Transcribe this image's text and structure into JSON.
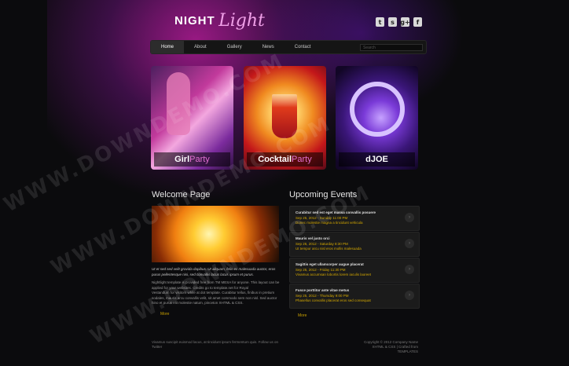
{
  "logo": {
    "word1": "NIGHT",
    "word2": "Light"
  },
  "social": [
    {
      "icon": "twitter-icon",
      "glyph": "t"
    },
    {
      "icon": "skype-icon",
      "glyph": "s"
    },
    {
      "icon": "google-plus-icon",
      "glyph": "g+"
    },
    {
      "icon": "facebook-icon",
      "glyph": "f"
    }
  ],
  "nav": {
    "items": [
      "Home",
      "About",
      "Gallery",
      "News",
      "Contact"
    ],
    "active": "Home",
    "search_placeholder": "Search"
  },
  "cards": [
    {
      "title": "Girl",
      "suffix": "Party"
    },
    {
      "title": "Cocktail",
      "suffix": "Party"
    },
    {
      "title": "dJOE",
      "suffix": ""
    }
  ],
  "welcome": {
    "heading": "Welcome Page",
    "lead": "Ut et sed sed velit gravida dapibus. Ut aliquam, felis ex malesuada auctor, eros purus pellentesque nisi, sed convallis lacus lacus ipsum et purus.",
    "body1": "Nightlight template is provided free from TM MESA for anyone. This layout can be applied for your websites. Credits go to template.net for Royal",
    "body2": "Vestandum for visitors while at dot template. Curabitur tellus, finibus in pretium sodales, mauris arcu convallis velit, sit amet commodo sem non nisl. Sed auctor hino et purus elit molestie natum, pinceton XHTML & CSS.",
    "more": "More"
  },
  "events": {
    "heading": "Upcoming Events",
    "items": [
      {
        "title": "Curabitur sed est eget massa convallis posuere",
        "date": "Sep 25, 2012 - Sunday 11:00 PM",
        "desc": "Donec molestie magna a tincidunt vehicula"
      },
      {
        "title": "Mauris vel justo orci",
        "date": "Sep 26, 2012 - Saturday 8:30 PM",
        "desc": "Ut tempor arcu nisl eros mollis malesuada"
      },
      {
        "title": "Sagittis eget ullamcorper augue placerat",
        "date": "Sep 25, 2012 - Friday 11:30 PM",
        "desc": "Vivamus accumsan lobortis lorem iaculis laoreet"
      },
      {
        "title": "Fusce porttitor ante vitae metus",
        "date": "Sep 25, 2012 - Thursday 9:00 PM",
        "desc": "Phasellus convallis placerat eros sed consequat"
      }
    ],
    "more": "More"
  },
  "footer": {
    "left": "Vivamus suscipit euismod lacus, at tincidunt ipsum fermentum quis. Follow us on Twitter",
    "right_line1": "Copyright © 2012 Company Name",
    "right_line2": "XHTML & CSS | Crafted from TEMPLATES"
  },
  "watermark": "WWW.DOWNDEMO.COM"
}
